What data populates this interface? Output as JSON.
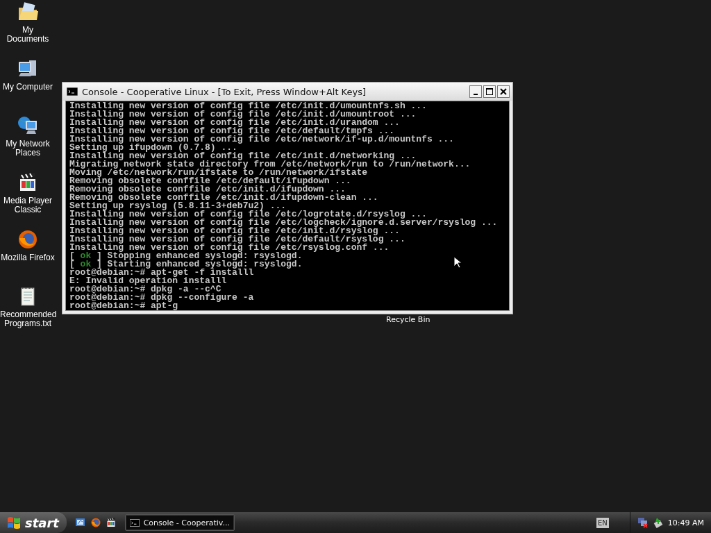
{
  "desktop": {
    "icons": [
      {
        "kind": "documents",
        "label": "My Documents"
      },
      {
        "kind": "computer",
        "label": "My Computer"
      },
      {
        "kind": "network",
        "label": "My Network Places"
      },
      {
        "kind": "mediaplayer",
        "label": "Media Player Classic"
      },
      {
        "kind": "firefox",
        "label": "Mozilla Firefox"
      },
      {
        "kind": "textfile",
        "label": "Recommended Programs.txt"
      }
    ],
    "partial_label": "Recycle Bin"
  },
  "window": {
    "title": "Console - Cooperative Linux - [To Exit, Press Window+Alt Keys]",
    "lines": [
      {
        "kind": "plain",
        "text": "Installing new version of config file /etc/init.d/umountnfs.sh ..."
      },
      {
        "kind": "plain",
        "text": "Installing new version of config file /etc/init.d/umountroot ..."
      },
      {
        "kind": "plain",
        "text": "Installing new version of config file /etc/init.d/urandom ..."
      },
      {
        "kind": "plain",
        "text": "Installing new version of config file /etc/default/tmpfs ..."
      },
      {
        "kind": "plain",
        "text": "Installing new version of config file /etc/network/if-up.d/mountnfs ..."
      },
      {
        "kind": "plain",
        "text": "Setting up ifupdown (0.7.8) ..."
      },
      {
        "kind": "plain",
        "text": "Installing new version of config file /etc/init.d/networking ..."
      },
      {
        "kind": "plain",
        "text": "Migrating network state directory from /etc/network/run to /run/network..."
      },
      {
        "kind": "plain",
        "text": "Moving /etc/network/run/ifstate to /run/network/ifstate"
      },
      {
        "kind": "plain",
        "text": "Removing obsolete conffile /etc/default/ifupdown ..."
      },
      {
        "kind": "plain",
        "text": "Removing obsolete conffile /etc/init.d/ifupdown ..."
      },
      {
        "kind": "plain",
        "text": "Removing obsolete conffile /etc/init.d/ifupdown-clean ..."
      },
      {
        "kind": "plain",
        "text": "Setting up rsyslog (5.8.11-3+deb7u2) ..."
      },
      {
        "kind": "plain",
        "text": "Installing new version of config file /etc/logrotate.d/rsyslog ..."
      },
      {
        "kind": "plain",
        "text": "Installing new version of config file /etc/logcheck/ignore.d.server/rsyslog ..."
      },
      {
        "kind": "plain",
        "text": "Installing new version of config file /etc/init.d/rsyslog ..."
      },
      {
        "kind": "plain",
        "text": "Installing new version of config file /etc/default/rsyslog ..."
      },
      {
        "kind": "plain",
        "text": "Installing new version of config file /etc/rsyslog.conf ..."
      },
      {
        "kind": "status",
        "before": "[ ",
        "status": "ok",
        "after": " ] Stopping enhanced syslogd: rsyslogd."
      },
      {
        "kind": "status",
        "before": "[ ",
        "status": "ok",
        "after": " ] Starting enhanced syslogd: rsyslogd."
      },
      {
        "kind": "plain",
        "text": "root@debian:~# apt-get -f installl"
      },
      {
        "kind": "plain",
        "text": "E: Invalid operation installl"
      },
      {
        "kind": "plain",
        "text": "root@debian:~# dpkg -a --c^C"
      },
      {
        "kind": "plain",
        "text": "root@debian:~# dpkg --configure -a"
      },
      {
        "kind": "plain",
        "text": "root@debian:~# apt-g"
      }
    ]
  },
  "taskbar": {
    "start": "start",
    "quick_launch": [
      {
        "kind": "desktop"
      },
      {
        "kind": "firefox"
      },
      {
        "kind": "mediaplayer"
      }
    ],
    "tasks": [
      {
        "label": "Console - Cooperativ...",
        "selected": true
      }
    ],
    "language": "EN",
    "clock": "10:49 AM"
  }
}
